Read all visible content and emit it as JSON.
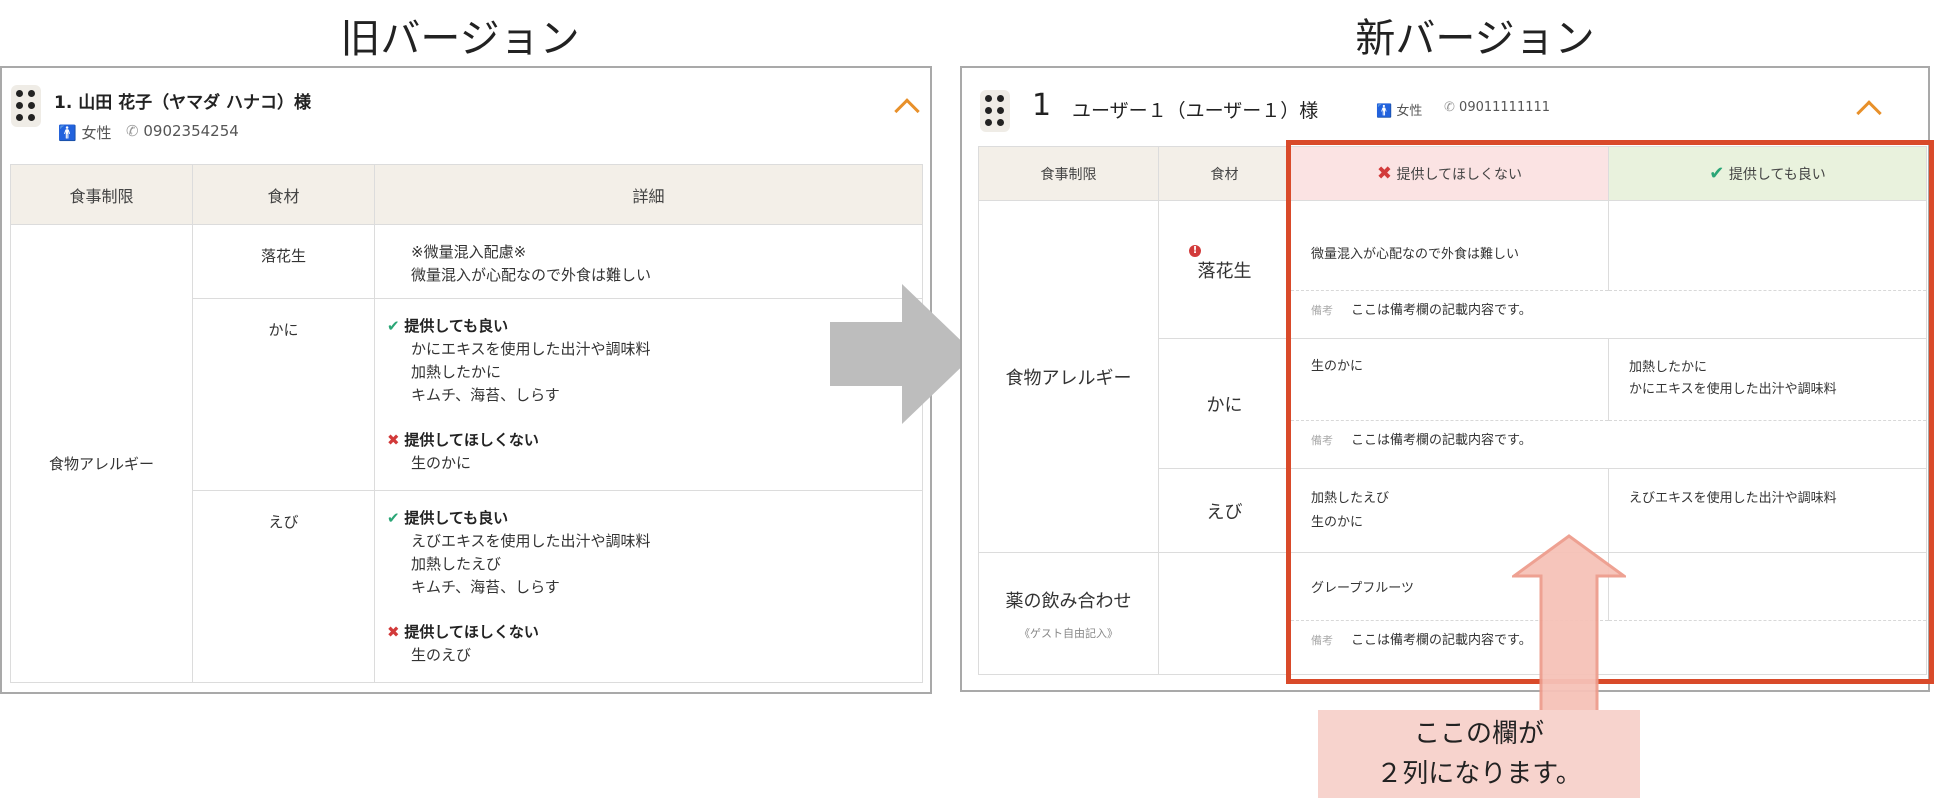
{
  "headings": {
    "old": "旧バージョン",
    "new": "新バージョン"
  },
  "old": {
    "title": "1. 山田 花子（ヤマダ ハナコ）様",
    "gender": "女性",
    "phone": "0902354254",
    "columns": [
      "食事制限",
      "食材",
      "詳細"
    ],
    "group": "食物アレルギー",
    "rows": [
      {
        "ingredient": "落花生",
        "lines": [
          "※微量混入配慮※",
          "微量混入が心配なので外食は難しい"
        ]
      },
      {
        "ingredient": "かに",
        "ok_label": "提供しても良い",
        "ok_lines": [
          "かにエキスを使用した出汁や調味料",
          "加熱したかに",
          "キムチ、海苔、しらす"
        ],
        "ng_label": "提供してほしくない",
        "ng_lines": [
          "生のかに"
        ]
      },
      {
        "ingredient": "えび",
        "ok_label": "提供しても良い",
        "ok_lines": [
          "えびエキスを使用した出汁や調味料",
          "加熱したえび",
          "キムチ、海苔、しらす"
        ],
        "ng_label": "提供してほしくない",
        "ng_lines": [
          "生のえび"
        ]
      }
    ]
  },
  "new": {
    "number": "1",
    "name": "ユーザー１（ユーザー１）様",
    "gender": "女性",
    "phone": "09011111111",
    "columns": [
      "食事制限",
      "食材",
      "提供してほしくない",
      "提供しても良い"
    ],
    "group_allergy": "食物アレルギー",
    "group_drug": "薬の飲み合わせ",
    "group_drug_sub": "《ゲスト自由記入》",
    "note_label": "備考",
    "note_text": "ここは備考欄の記載内容です。",
    "rows": [
      {
        "ingredient": "落花生",
        "ng": [
          "微量混入が心配なので外食は難しい"
        ],
        "ok": []
      },
      {
        "ingredient": "かに",
        "ng": [
          "生のかに"
        ],
        "ok": [
          "加熱したかに",
          "かにエキスを使用した出汁や調味料"
        ]
      },
      {
        "ingredient": "えび",
        "ng": [
          "加熱したえび",
          "生のかに"
        ],
        "ok": [
          "えびエキスを使用した出汁や調味料"
        ]
      },
      {
        "ingredient": "",
        "ng": [
          "グレープフルーツ"
        ],
        "ok": []
      }
    ]
  },
  "callout": {
    "line1": "ここの欄が",
    "line2": "２列になります。"
  },
  "colors": {
    "accent": "#e8902a",
    "highlight": "#d94a2a",
    "ok": "#2aa676",
    "ng": "#d23a3a",
    "callout_bg": "#f7d3cd",
    "arrow": "#bdbdbd"
  }
}
